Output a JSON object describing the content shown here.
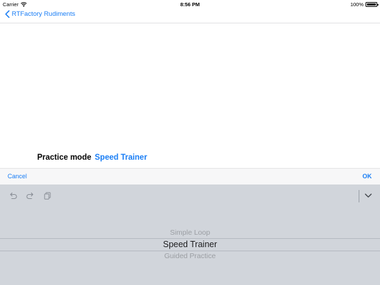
{
  "status_bar": {
    "carrier": "Carrier",
    "time": "8:56 PM",
    "battery_text": "100%",
    "battery_level": 1.0
  },
  "nav": {
    "back_label": "RTFactory Rudiments"
  },
  "form": {
    "label": "Practice mode",
    "value": "Speed Trainer"
  },
  "picker_toolbar": {
    "cancel_label": "Cancel",
    "ok_label": "OK"
  },
  "picker": {
    "options": [
      "Simple Loop",
      "Speed Trainer",
      "Guided Practice"
    ],
    "selected_index": 1
  },
  "colors": {
    "accent": "#1a7ef5",
    "keyboard_bg": "#d1d5db",
    "toolbar_bg": "#f7f7f8"
  },
  "icons": {
    "undo": "undo-icon",
    "redo": "redo-icon",
    "paste": "paste-icon",
    "dismiss": "chevron-down-icon",
    "back": "chevron-left-icon",
    "wifi": "wifi-icon",
    "battery": "battery-icon"
  }
}
